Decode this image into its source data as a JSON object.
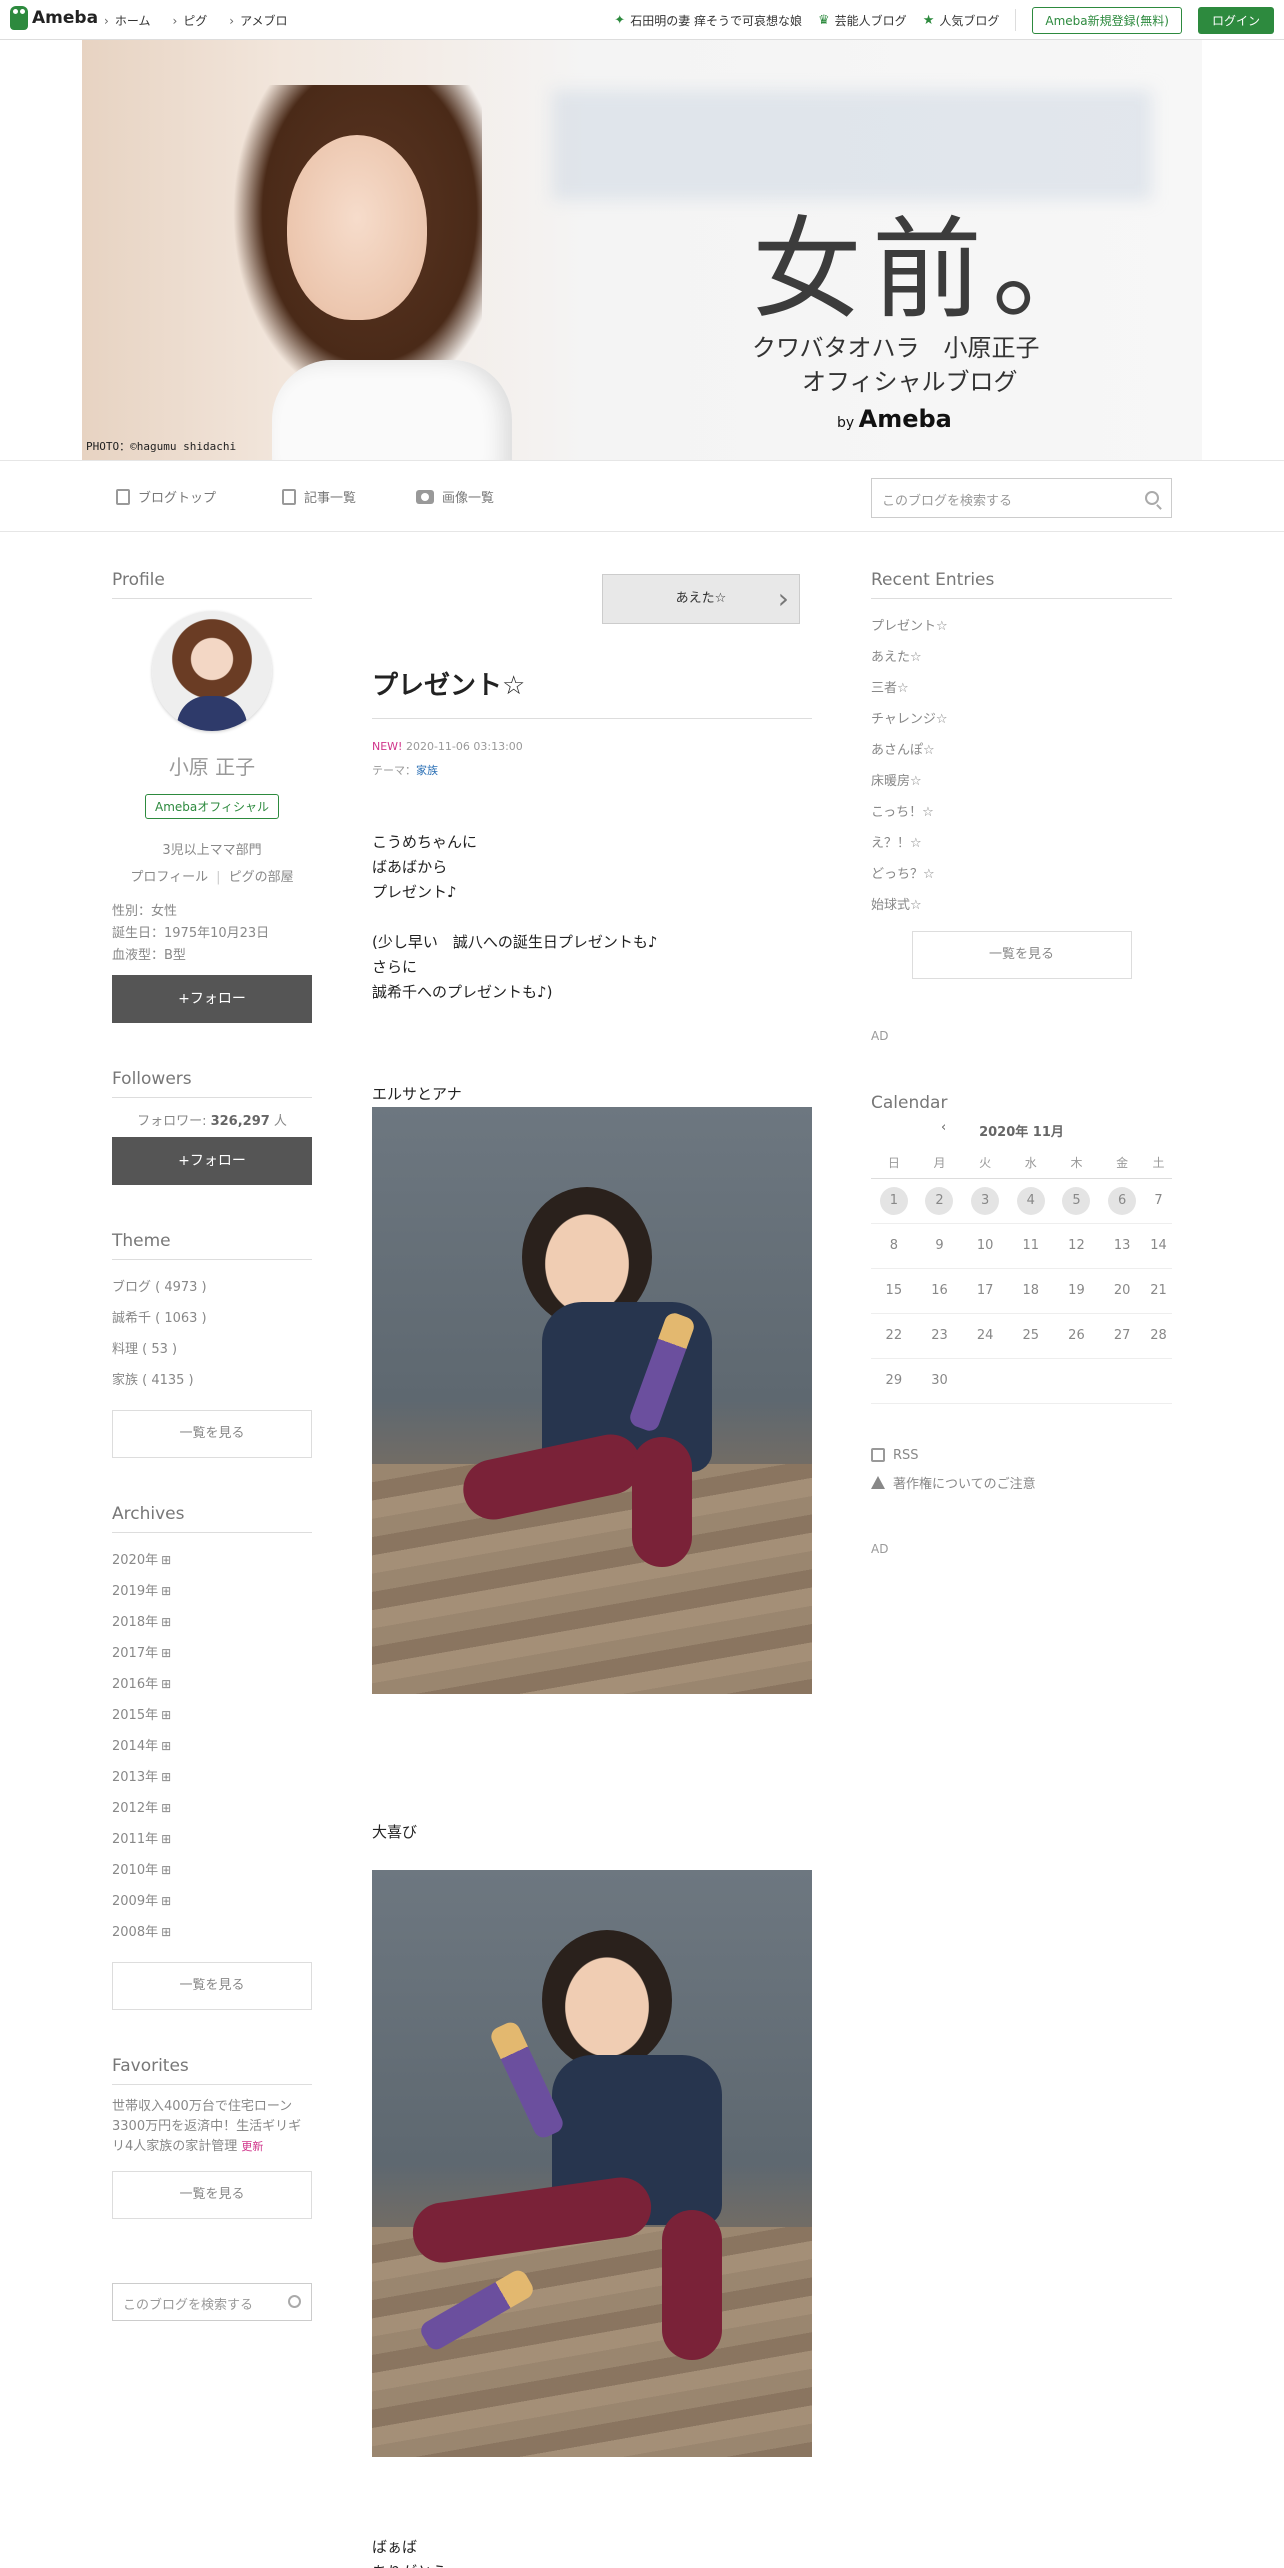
{
  "topbar": {
    "logo": "Ameba",
    "nav": [
      "ホーム",
      "ピグ",
      "アメブロ"
    ],
    "links": [
      "石田明の妻 痒そうで可哀想な娘",
      "芸能人ブログ",
      "人気ブログ"
    ],
    "register": "Ameba新規登録(無料)",
    "login": "ログイン"
  },
  "header": {
    "title": "女前。",
    "subtitle1": "クワバタオハラ　小原正子",
    "subtitle2": "オフィシャルブログ",
    "by": "by",
    "brand": "Ameba",
    "photo_credit": "PHOTO：©hagumu shidachi"
  },
  "blognav": {
    "items": [
      "ブログトップ",
      "記事一覧",
      "画像一覧"
    ],
    "search_placeholder": "このブログを検索する"
  },
  "profile": {
    "heading": "Profile",
    "name": "小原 正子",
    "badge": "Amebaオフィシャル",
    "description": "3児以上ママ部門",
    "link1": "プロフィール",
    "link2": "ピグの部屋",
    "gender": "性別：女性",
    "birthday": "誕生日：1975年10月23日",
    "blood": "血液型：B型",
    "follow": "+フォロー"
  },
  "followers": {
    "heading": "Followers",
    "label": "フォロワー: ",
    "count": "326,297",
    "unit": " 人",
    "follow": "+フォロー"
  },
  "theme": {
    "heading": "Theme",
    "items": [
      "ブログ ( 4973 )",
      "誠希千 ( 1063 )",
      "料理 ( 53 )",
      "家族 ( 4135 )"
    ],
    "more": "一覧を見る"
  },
  "archives": {
    "heading": "Archives",
    "years": [
      "2020年",
      "2019年",
      "2018年",
      "2017年",
      "2016年",
      "2015年",
      "2014年",
      "2013年",
      "2012年",
      "2011年",
      "2010年",
      "2009年",
      "2008年"
    ],
    "more": "一覧を見る"
  },
  "favorites": {
    "heading": "Favorites",
    "text": "世帯収入400万台で住宅ローン3300万円を返済中！生活ギリギリ4人家族の家計管理",
    "new_label": "更新",
    "more": "一覧を見る",
    "search_placeholder": "このブログを検索する"
  },
  "article": {
    "next": "あえた☆",
    "title": "プレゼント☆",
    "new_label": "NEW!",
    "date": "2020-11-06 03:13:00",
    "theme_label": "テーマ：",
    "theme": "家族",
    "para1": [
      "こうめちゃんに",
      "ばあばから",
      "プレゼント♪"
    ],
    "para2": [
      "(少し早い　誠八への誕生日プレゼントも♪",
      "さらに",
      "誠希千へのプレゼントも♪)"
    ],
    "caption1": "エルサとアナ",
    "caption2": "大喜び",
    "para3": [
      "ばぁば",
      "ありがとうーー"
    ]
  },
  "recent": {
    "heading": "Recent Entries",
    "items": [
      "プレゼント☆",
      "あえた☆",
      "三者☆",
      "チャレンジ☆",
      "あさんぽ☆",
      "床暖房☆",
      "こっち！☆",
      "え？！☆",
      "どっち？☆",
      "始球式☆"
    ],
    "more": "一覧を見る",
    "ad": "AD"
  },
  "calendar": {
    "heading": "Calendar",
    "month": "2020年 11月",
    "weekdays": [
      "日",
      "月",
      "火",
      "水",
      "木",
      "金",
      "土"
    ],
    "weeks": [
      [
        "1",
        "2",
        "3",
        "4",
        "5",
        "6",
        "7"
      ],
      [
        "8",
        "9",
        "10",
        "11",
        "12",
        "13",
        "14"
      ],
      [
        "15",
        "16",
        "17",
        "18",
        "19",
        "20",
        "21"
      ],
      [
        "22",
        "23",
        "24",
        "25",
        "26",
        "27",
        "28"
      ],
      [
        "29",
        "30",
        "",
        "",
        "",
        "",
        ""
      ]
    ],
    "has_posts": [
      "1",
      "2",
      "3",
      "4",
      "5",
      "6"
    ]
  },
  "footer_right": {
    "rss": "RSS",
    "copyright": "著作権についてのご注意",
    "ad": "AD"
  },
  "colors": {
    "accent": "#2d8a3e",
    "new": "#d0348a",
    "link": "#2a6fb5"
  }
}
